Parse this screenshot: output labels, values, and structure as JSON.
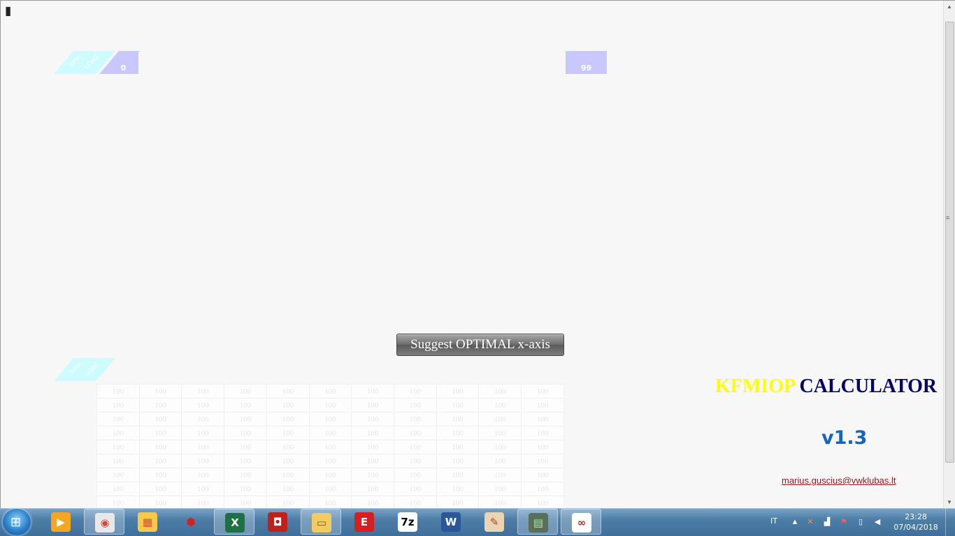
{
  "labels": {
    "top_left_para_text_1": "RPM",
    "top_left_para_text_2": "LOAD",
    "top_left_value": "0",
    "top_right_value": "99",
    "bottom_para_text_1": "RPM",
    "bottom_para_text_2": "LOAD"
  },
  "button": {
    "label": "Suggest OPTIMAL x-axis"
  },
  "grid": {
    "rows": [
      [
        "100",
        "100",
        "100",
        "100",
        "100",
        "100",
        "100",
        "100",
        "100",
        "100",
        "100"
      ],
      [
        "100",
        "100",
        "100",
        "100",
        "100",
        "100",
        "100",
        "100",
        "100",
        "100",
        "100"
      ],
      [
        "100",
        "100",
        "100",
        "100",
        "100",
        "100",
        "100",
        "100",
        "100",
        "100",
        "100"
      ],
      [
        "100",
        "100",
        "100",
        "100",
        "100",
        "100",
        "100",
        "100",
        "100",
        "100",
        "100"
      ],
      [
        "100",
        "100",
        "100",
        "100",
        "100",
        "100",
        "100",
        "100",
        "100",
        "100",
        "100"
      ],
      [
        "100",
        "100",
        "100",
        "100",
        "100",
        "100",
        "100",
        "100",
        "100",
        "100",
        "100"
      ],
      [
        "100",
        "100",
        "100",
        "100",
        "100",
        "100",
        "100",
        "100",
        "100",
        "100",
        "100"
      ],
      [
        "100",
        "100",
        "100",
        "100",
        "100",
        "100",
        "100",
        "100",
        "100",
        "100",
        "100"
      ],
      [
        "100",
        "100",
        "100",
        "100",
        "100",
        "100",
        "100",
        "100",
        "100",
        "100",
        "100"
      ]
    ]
  },
  "branding": {
    "title_part1": "KFMIOP",
    "title_part2": "CALCULATOR",
    "version": "v1.3",
    "email": "marius.guscius@vwklubas.lt"
  },
  "taskbar": {
    "items": [
      {
        "name": "media-player-icon",
        "glyph": "▶",
        "bg": "#f5a623",
        "fg": "#ffffff",
        "active": false
      },
      {
        "name": "chrome-icon",
        "glyph": "◉",
        "bg": "#e8e8e8",
        "fg": "#db4437",
        "active": true
      },
      {
        "name": "image-viewer-icon",
        "glyph": "▦",
        "bg": "#f7c948",
        "fg": "#d0502a",
        "active": false
      },
      {
        "name": "ruby-icon",
        "glyph": "⬢",
        "bg": "transparent",
        "fg": "#d32020",
        "active": false
      },
      {
        "name": "excel-icon",
        "glyph": "X",
        "bg": "#1e7145",
        "fg": "#ffffff",
        "active": true
      },
      {
        "name": "red-app-icon",
        "glyph": "◘",
        "bg": "#c0201c",
        "fg": "#ffffff",
        "active": false
      },
      {
        "name": "folder-icon",
        "glyph": "▭",
        "bg": "#f2cc63",
        "fg": "#7a5a10",
        "active": true
      },
      {
        "name": "ecm-icon",
        "glyph": "E",
        "bg": "#d42020",
        "fg": "#ffffff",
        "active": false
      },
      {
        "name": "7zip-icon",
        "glyph": "7z",
        "bg": "#ffffff",
        "fg": "#000000",
        "active": false
      },
      {
        "name": "word-icon",
        "glyph": "W",
        "bg": "#2b579a",
        "fg": "#ffffff",
        "active": false
      },
      {
        "name": "paint-icon",
        "glyph": "✎",
        "bg": "#e9d6b0",
        "fg": "#c0392b",
        "active": false
      },
      {
        "name": "computer-icon",
        "glyph": "▤",
        "bg": "#5a6e5a",
        "fg": "#9ff09f",
        "active": true
      },
      {
        "name": "road-app-icon",
        "glyph": "∞",
        "bg": "#ffffff",
        "fg": "#c0201c",
        "active": true
      }
    ],
    "language": "IT",
    "time": "23:28",
    "date": "07/04/2018"
  }
}
